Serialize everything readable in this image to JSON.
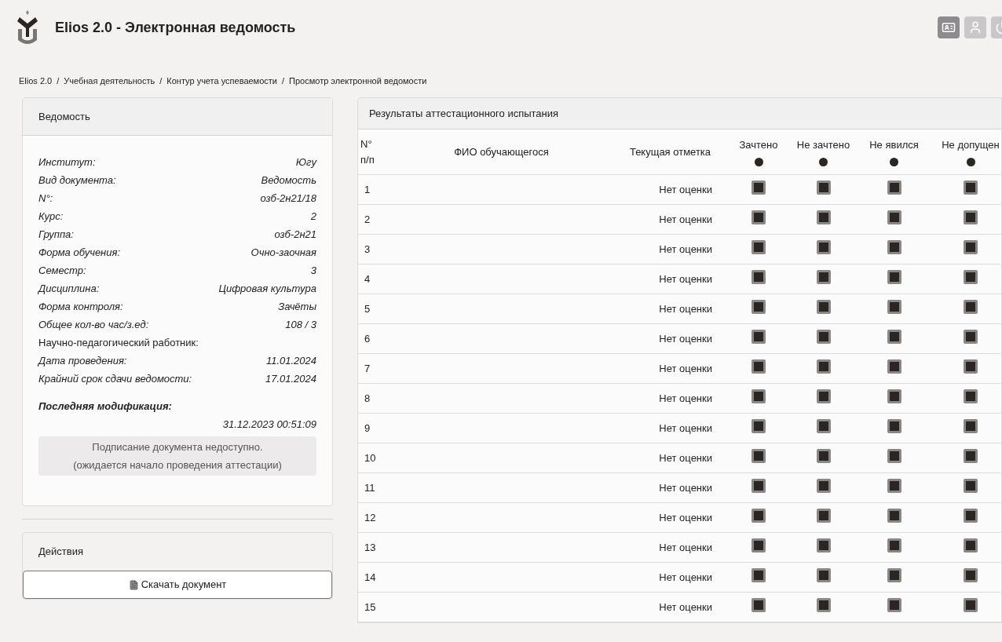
{
  "header": {
    "title": "Elios 2.0 - Электронная ведомость"
  },
  "breadcrumb": {
    "separators": [
      "/",
      "/",
      "/"
    ],
    "items": [
      "Elios 2.0",
      "Учебная деятельность",
      "Контур учета успеваемости",
      "Просмотр электронной ведомости"
    ]
  },
  "sheet": {
    "title": "Ведомость",
    "fields": [
      {
        "kind": "pair",
        "label": "Институт:",
        "value": "Югу"
      },
      {
        "kind": "pair",
        "label": "Вид документа:",
        "value": "Ведомость"
      },
      {
        "kind": "pair",
        "label": "N°:",
        "value": "озб-2н21/18"
      },
      {
        "kind": "pair",
        "label": "Курс:",
        "value": "2"
      },
      {
        "kind": "pair",
        "label": "Группа:",
        "value": "озб-2н21"
      },
      {
        "kind": "pair",
        "label": "Форма обучения:",
        "value": "Очно-заочная"
      },
      {
        "kind": "pair",
        "label": "Семестр:",
        "value": "3"
      },
      {
        "kind": "pair",
        "label": "Дисциплина:",
        "value": "Цифровая культура"
      },
      {
        "kind": "pair",
        "label": "Форма контроля:",
        "value": "Зачёты"
      },
      {
        "kind": "pair",
        "label": "Общее кол-во час/з.ед:",
        "value": "108 / 3"
      },
      {
        "kind": "label",
        "label": "Научно-педагогический работник:"
      },
      {
        "kind": "pair",
        "label": "Дата проведения:",
        "value": "11.01.2024"
      },
      {
        "kind": "pair",
        "label": "Крайний срок сдачи ведомости:",
        "value": "17.01.2024"
      }
    ],
    "modified_label": "Последняя модификация:",
    "modified_value": "31.12.2023 00:51:09",
    "notice": [
      "Подписание документа недоступно.",
      "(ожидается начало проведения аттестации)"
    ]
  },
  "actions": {
    "title": "Действия",
    "download_button": "Скачать документ"
  },
  "results": {
    "title": "Результаты аттестационного испытания",
    "columns": {
      "number": [
        "N°",
        "п/п"
      ],
      "name": "ФИО обучающегося",
      "current": "Текущая отметка"
    },
    "options": [
      {
        "label": "Зачтено",
        "selected": false
      },
      {
        "label": "Не зачтено",
        "selected": false
      },
      {
        "label": "Не явился",
        "selected": false
      },
      {
        "label": "Не допущен",
        "selected": false
      }
    ],
    "rows": [
      {
        "number": "1",
        "current": "Нет оценки",
        "marks": [
          false,
          false,
          false,
          false
        ]
      },
      {
        "number": "2",
        "current": "Нет оценки",
        "marks": [
          false,
          false,
          false,
          false
        ]
      },
      {
        "number": "3",
        "current": "Нет оценки",
        "marks": [
          false,
          false,
          false,
          false
        ]
      },
      {
        "number": "4",
        "current": "Нет оценки",
        "marks": [
          false,
          false,
          false,
          false
        ]
      },
      {
        "number": "5",
        "current": "Нет оценки",
        "marks": [
          false,
          false,
          false,
          false
        ]
      },
      {
        "number": "6",
        "current": "Нет оценки",
        "marks": [
          false,
          false,
          false,
          false
        ]
      },
      {
        "number": "7",
        "current": "Нет оценки",
        "marks": [
          false,
          false,
          false,
          false
        ]
      },
      {
        "number": "8",
        "current": "Нет оценки",
        "marks": [
          false,
          false,
          false,
          false
        ]
      },
      {
        "number": "9",
        "current": "Нет оценки",
        "marks": [
          false,
          false,
          false,
          false
        ]
      },
      {
        "number": "10",
        "current": "Нет оценки",
        "marks": [
          false,
          false,
          false,
          false
        ]
      },
      {
        "number": "11",
        "current": "Нет оценки",
        "marks": [
          false,
          false,
          false,
          false
        ]
      },
      {
        "number": "12",
        "current": "Нет оценки",
        "marks": [
          false,
          false,
          false,
          false
        ]
      },
      {
        "number": "13",
        "current": "Нет оценки",
        "marks": [
          false,
          false,
          false,
          false
        ]
      },
      {
        "number": "14",
        "current": "Нет оценки",
        "marks": [
          false,
          false,
          false,
          false
        ]
      },
      {
        "number": "15",
        "current": "Нет оценки",
        "marks": [
          false,
          false,
          false,
          false
        ]
      }
    ]
  }
}
